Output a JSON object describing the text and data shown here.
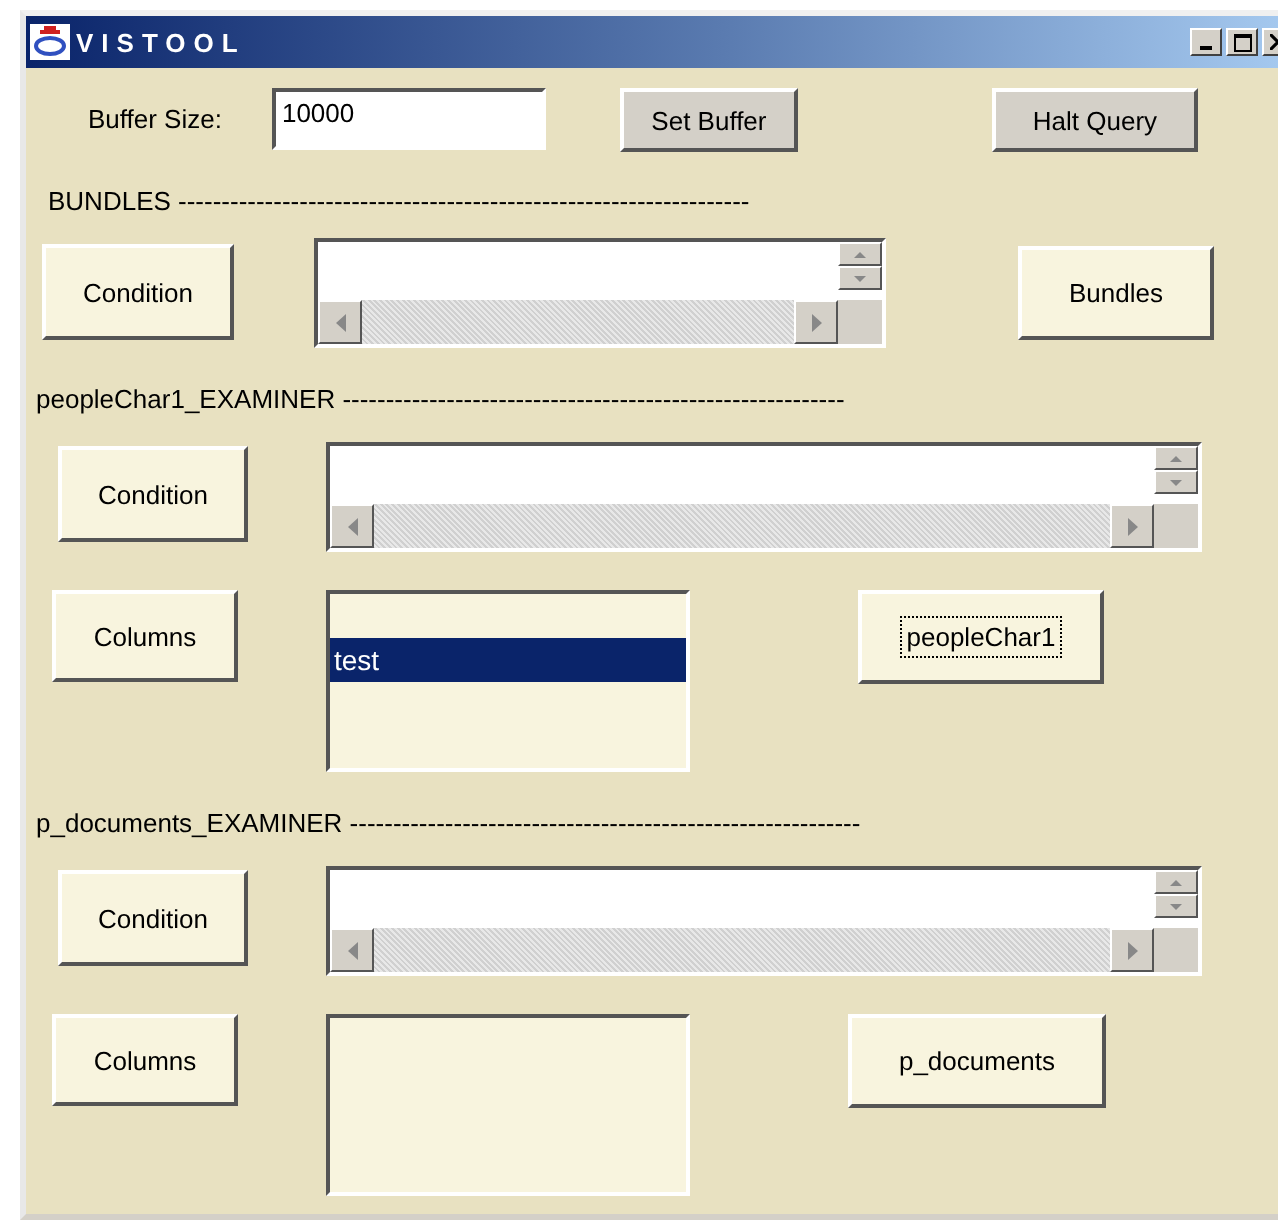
{
  "window": {
    "title": "VISTOOL"
  },
  "buffer": {
    "label": "Buffer Size:",
    "value": "10000",
    "set_button": "Set Buffer",
    "halt_button": "Halt Query"
  },
  "sections": [
    {
      "kind": "bundles",
      "heading": "BUNDLES ------------------------------------------------------------------",
      "condition_button": "Condition",
      "action_button": {
        "label": "Bundles",
        "focused": false
      }
    },
    {
      "kind": "examiner",
      "heading": "peopleChar1_EXAMINER ----------------------------------------------------------",
      "condition_button": "Condition",
      "columns": {
        "button": "Columns",
        "items": [
          {
            "label": "test",
            "selected": true
          }
        ]
      },
      "action_button": {
        "label": "peopleChar1",
        "focused": true
      }
    },
    {
      "kind": "examiner",
      "heading": "p_documents_EXAMINER -----------------------------------------------------------",
      "condition_button": "Condition",
      "columns": {
        "button": "Columns"
      },
      "action_button": {
        "label": "p_documents",
        "focused": false
      }
    }
  ]
}
